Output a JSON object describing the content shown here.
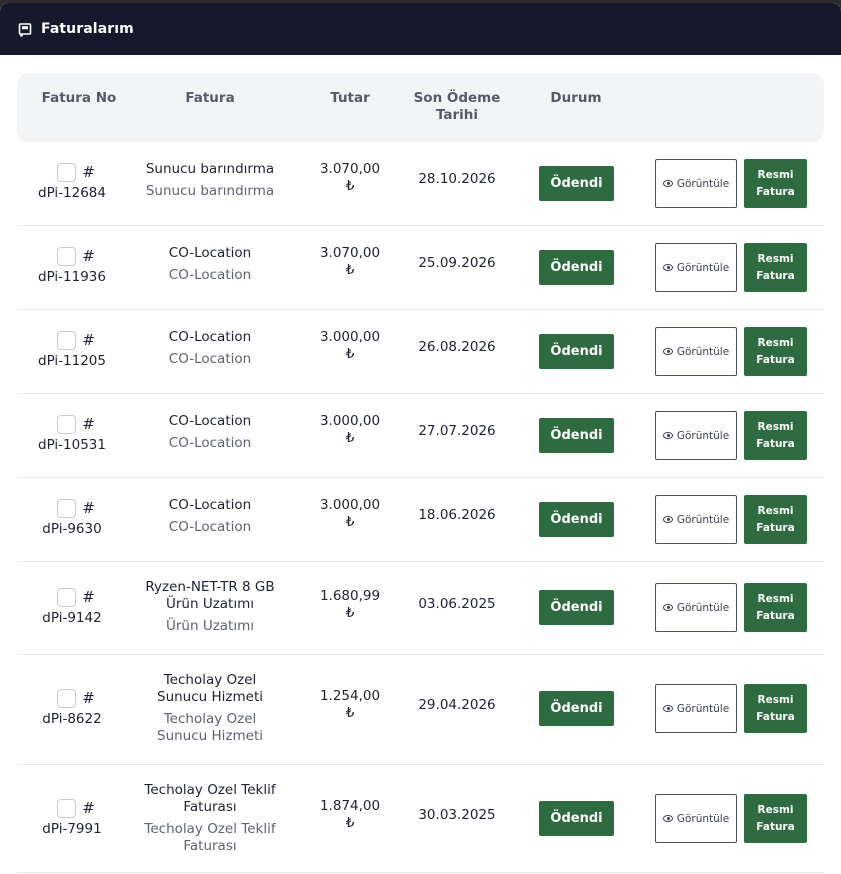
{
  "app": {
    "title": "Faturalarım"
  },
  "table": {
    "headers": {
      "no": "Fatura No",
      "fatura": "Fatura",
      "tutar": "Tutar",
      "son_odeme_1": "Son Ödeme",
      "son_odeme_2": "Tarihi",
      "durum": "Durum"
    },
    "rows": [
      {
        "hash": "#",
        "no": "dPi-12684",
        "title": [
          "Sunucu barındırma"
        ],
        "subtitle": [
          "Sunucu barındırma"
        ],
        "amount": "3.070,00",
        "currency": "₺",
        "date": "28.10.2026",
        "status": "Ödendi",
        "view": "Görüntüle",
        "resmi1": "Resmi",
        "resmi2": "Fatura"
      },
      {
        "hash": "#",
        "no": "dPi-11936",
        "title": [
          "CO-Location"
        ],
        "subtitle": [
          "CO-Location"
        ],
        "amount": "3.070,00",
        "currency": "₺",
        "date": "25.09.2026",
        "status": "Ödendi",
        "view": "Görüntüle",
        "resmi1": "Resmi",
        "resmi2": "Fatura"
      },
      {
        "hash": "#",
        "no": "dPi-11205",
        "title": [
          "CO-Location"
        ],
        "subtitle": [
          "CO-Location"
        ],
        "amount": "3.000,00",
        "currency": "₺",
        "date": "26.08.2026",
        "status": "Ödendi",
        "view": "Görüntüle",
        "resmi1": "Resmi",
        "resmi2": "Fatura"
      },
      {
        "hash": "#",
        "no": "dPi-10531",
        "title": [
          "CO-Location"
        ],
        "subtitle": [
          "CO-Location"
        ],
        "amount": "3.000,00",
        "currency": "₺",
        "date": "27.07.2026",
        "status": "Ödendi",
        "view": "Görüntüle",
        "resmi1": "Resmi",
        "resmi2": "Fatura"
      },
      {
        "hash": "#",
        "no": "dPi-9630",
        "title": [
          "CO-Location"
        ],
        "subtitle": [
          "CO-Location"
        ],
        "amount": "3.000,00",
        "currency": "₺",
        "date": "18.06.2026",
        "status": "Ödendi",
        "view": "Görüntüle",
        "resmi1": "Resmi",
        "resmi2": "Fatura"
      },
      {
        "hash": "#",
        "no": "dPi-9142",
        "title": [
          "Ryzen-NET-TR 8 GB",
          "Ürün Uzatımı"
        ],
        "subtitle": [
          "Ürün Uzatımı"
        ],
        "amount": "1.680,99",
        "currency": "₺",
        "date": "03.06.2025",
        "status": "Ödendi",
        "view": "Görüntüle",
        "resmi1": "Resmi",
        "resmi2": "Fatura"
      },
      {
        "hash": "#",
        "no": "dPi-8622",
        "title": [
          "Techolay Ozel",
          "Sunucu Hizmeti"
        ],
        "subtitle": [
          "Techolay Ozel",
          "Sunucu Hizmeti"
        ],
        "amount": "1.254,00",
        "currency": "₺",
        "date": "29.04.2026",
        "status": "Ödendi",
        "view": "Görüntüle",
        "resmi1": "Resmi",
        "resmi2": "Fatura"
      },
      {
        "hash": "#",
        "no": "dPi-7991",
        "title": [
          "Techolay Ozel Teklif",
          "Faturası"
        ],
        "subtitle": [
          "Techolay Ozel Teklif",
          "Faturası"
        ],
        "amount": "1.874,00",
        "currency": "₺",
        "date": "30.03.2025",
        "status": "Ödendi",
        "view": "Görüntüle",
        "resmi1": "Resmi",
        "resmi2": "Fatura"
      }
    ]
  }
}
